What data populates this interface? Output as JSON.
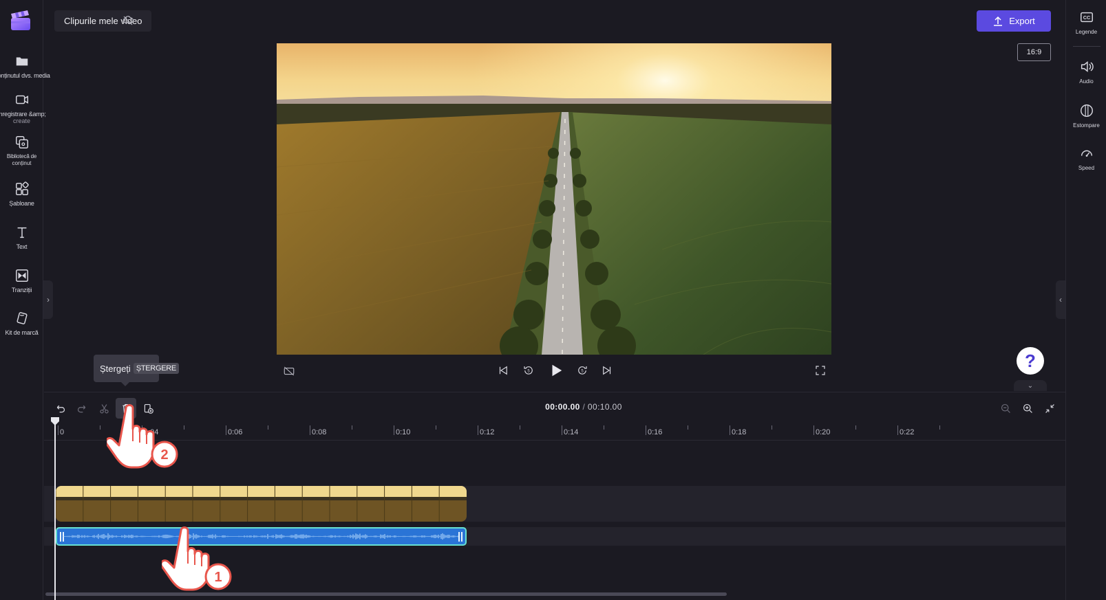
{
  "project": {
    "title": "Clipurile mele video"
  },
  "left_rail": {
    "items": [
      {
        "label": "Conținutul dvs. media",
        "sub": ""
      },
      {
        "label": "Înregistrare &amp;",
        "sub": "create"
      },
      {
        "label": "Bibliotecă de",
        "sub": "conținut"
      },
      {
        "label": "Șabloane",
        "sub": ""
      },
      {
        "label": "Text",
        "sub": ""
      },
      {
        "label": "Tranziții",
        "sub": ""
      },
      {
        "label": "Kit de marcă",
        "sub": ""
      }
    ]
  },
  "right_rail": {
    "items": [
      {
        "label": "Legende"
      },
      {
        "label": "Audio"
      },
      {
        "label": "Estompare"
      },
      {
        "label": "Speed"
      }
    ]
  },
  "toolbar": {
    "export_label": "Export",
    "aspect_ratio": "16:9"
  },
  "help": {
    "label": "?"
  },
  "tooltip": {
    "text": "Ștergeți",
    "shortcut": "ȘTERGERE"
  },
  "timeline": {
    "current_time": "00:00.00",
    "separator": "/",
    "total_time": "00:10.00",
    "ruler_labels": [
      "0",
      "0:04",
      "0:06",
      "0:08",
      "0:10",
      "0:12",
      "0:14",
      "0:16",
      "0:18",
      "0:20",
      "0:22"
    ]
  },
  "callouts": {
    "step1": "1",
    "step2": "2"
  },
  "colors": {
    "accent": "#5b4ae0",
    "audio_clip": "#2a74d6",
    "audio_border": "#67e0d0",
    "background": "#1b1a22"
  },
  "icons": [
    "clapperboard-logo-icon",
    "folder-icon",
    "camera-icon",
    "content-library-icon",
    "templates-icon",
    "text-icon",
    "transitions-icon",
    "brand-kit-icon",
    "captions-icon",
    "speaker-icon",
    "fade-icon",
    "speed-icon",
    "export-upload-icon",
    "undo-icon",
    "redo-icon",
    "scissors-icon",
    "trash-icon",
    "add-media-icon",
    "zoom-out-icon",
    "zoom-in-icon",
    "fit-icon",
    "camera-off-icon",
    "skip-back-icon",
    "rewind-5-icon",
    "play-icon",
    "forward-5-icon",
    "skip-forward-icon",
    "fullscreen-icon"
  ]
}
